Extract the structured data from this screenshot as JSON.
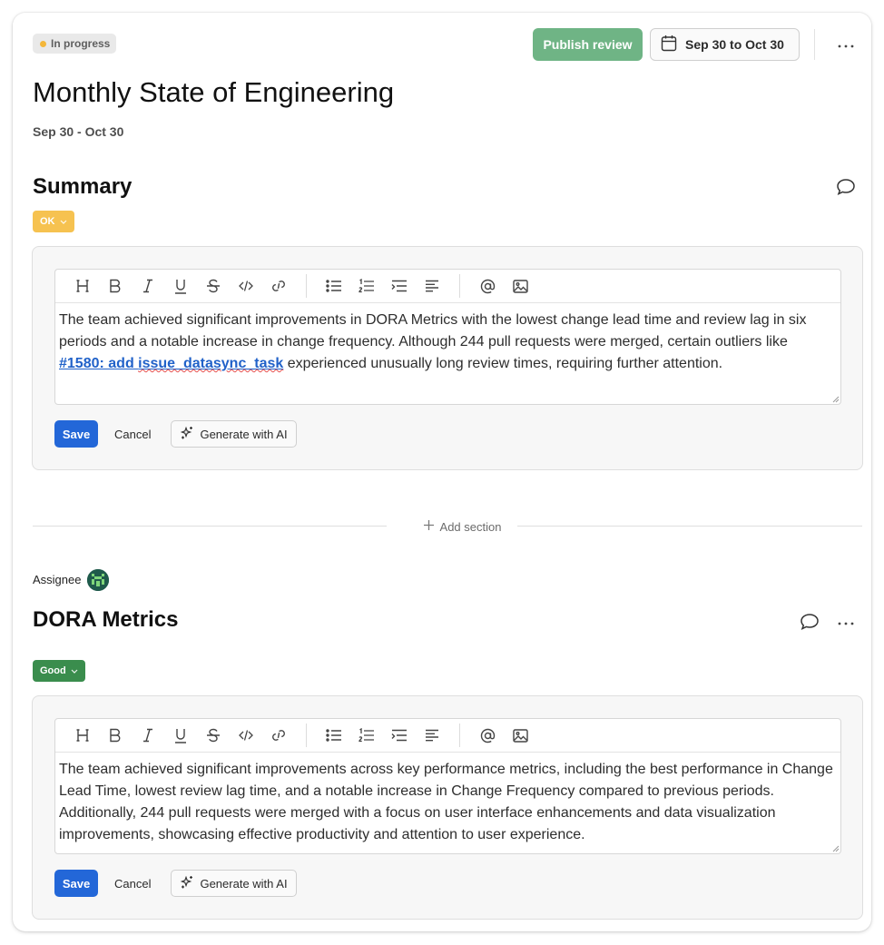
{
  "header": {
    "status": "In progress",
    "status_color": "#f4b73a",
    "publish_label": "Publish review",
    "date_range_label": "Sep 30 to Oct 30",
    "more_icon": "more-horizontal-icon"
  },
  "page": {
    "title": "Monthly State of Engineering",
    "subtitle": "Sep 30 - Oct 30"
  },
  "toolbar_icons": [
    "heading-icon",
    "bold-icon",
    "italic-icon",
    "underline-icon",
    "strikethrough-icon",
    "code-icon",
    "link-icon",
    "bullet-list-icon",
    "numbered-list-icon",
    "indent-icon",
    "align-left-icon",
    "mention-icon",
    "image-icon"
  ],
  "sections": [
    {
      "title": "Summary",
      "rating": "OK",
      "rating_color": "#f6c250",
      "text_before": "The team achieved significant improvements in DORA Metrics with the lowest change lead time and review lag in six periods and a notable increase in change frequency. Although 244 pull requests were merged, certain outliers like ",
      "link_prefix": "#1580: add ",
      "link_spell": "issue_datasync_task",
      "text_after": " experienced unusually long review times, requiring further attention.",
      "save_label": "Save",
      "cancel_label": "Cancel",
      "ai_label": "Generate with AI"
    },
    {
      "assignee_label": "Assignee",
      "title": "DORA Metrics",
      "rating": "Good",
      "rating_color": "#3a8d4d",
      "text": "The team achieved significant improvements across key performance metrics, including the best performance in Change Lead Time, lowest review lag time, and a notable increase in Change Frequency compared to previous periods. Additionally, 244 pull requests were merged with a focus on user interface enhancements and data visualization improvements, showcasing effective productivity and attention to user experience.",
      "save_label": "Save",
      "cancel_label": "Cancel",
      "ai_label": "Generate with AI"
    }
  ],
  "add_section_label": "Add section",
  "colors": {
    "accent": "#2367d8",
    "publish": "#6fb485",
    "link": "#2162c9"
  }
}
